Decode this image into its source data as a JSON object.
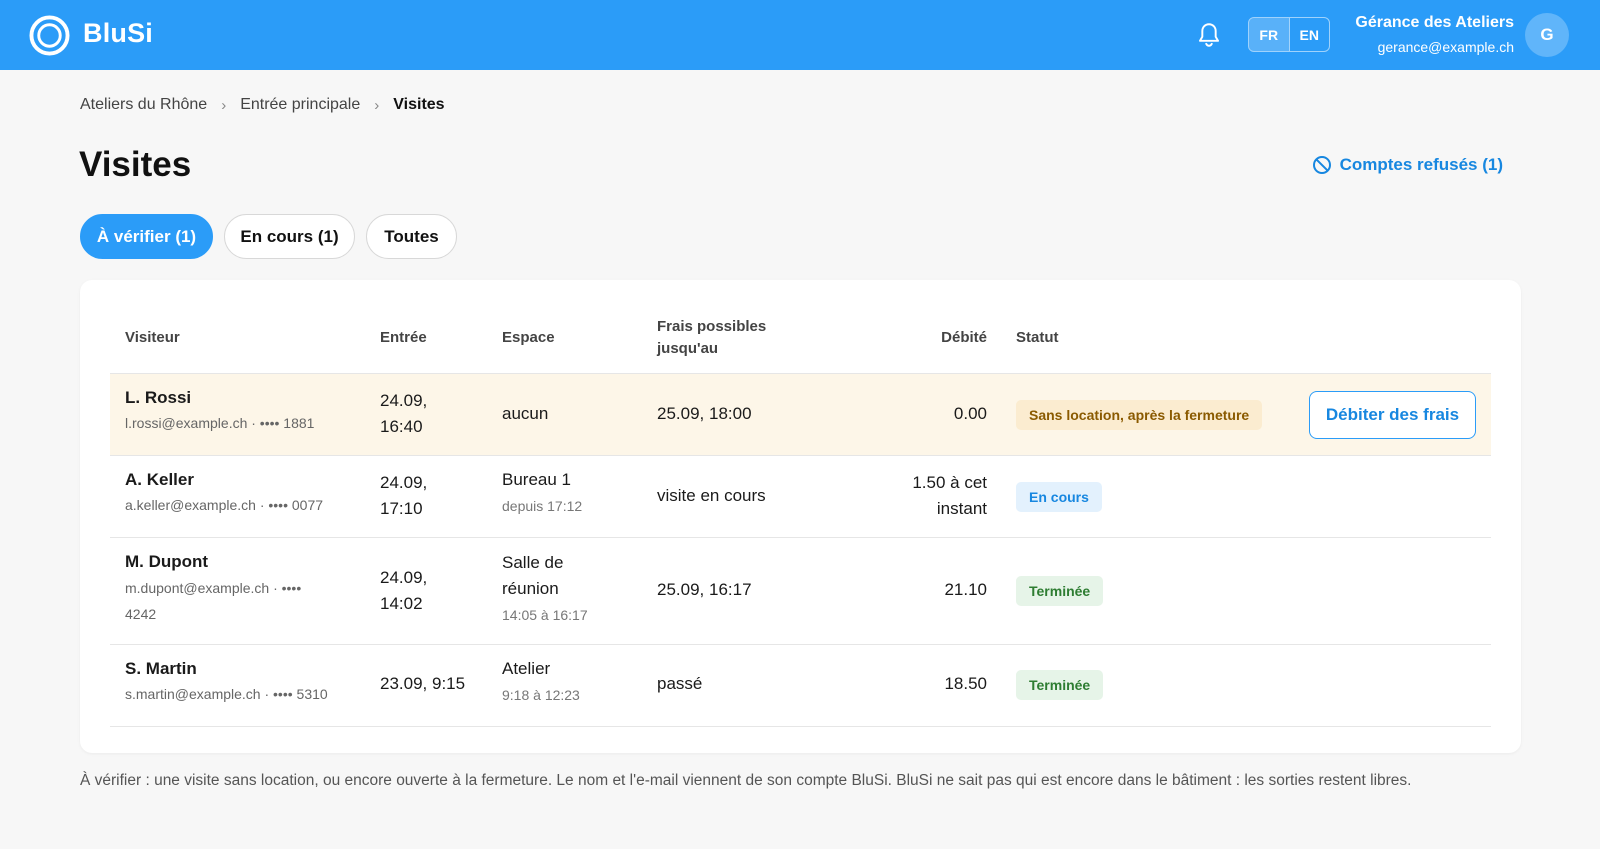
{
  "app": {
    "brand": "BluSi",
    "colors": {
      "primary": "#2b9cf8",
      "link": "#1787e0",
      "warning_bg": "#fdf6e8"
    },
    "icons": {
      "logo": "blusi-logo-icon",
      "notifications": "bell-icon"
    }
  },
  "header": {
    "languages": [
      {
        "code": "FR",
        "active": true
      },
      {
        "code": "EN",
        "active": false
      }
    ],
    "user": {
      "name": "Gérance des Ateliers",
      "email": "gerance@example.ch",
      "initial": "G"
    }
  },
  "breadcrumb": {
    "items": [
      "Ateliers du Rhône",
      "Entrée principale",
      "Visites"
    ]
  },
  "page": {
    "title": "Visites",
    "refused_link": "Comptes refusés (1)"
  },
  "tabs": [
    {
      "label": "À vérifier (1)",
      "active": true
    },
    {
      "label": "En cours (1)",
      "active": false
    },
    {
      "label": "Toutes",
      "active": false
    }
  ],
  "table": {
    "columns": {
      "visitor": "Visiteur",
      "entry": "Entrée",
      "space": "Espace",
      "fees_line1": "Frais possibles",
      "fees_line2": "jusqu'au",
      "charged": "Débité",
      "status": "Statut"
    },
    "rows": [
      {
        "name": "L. Rossi",
        "meta": "l.rossi@example.ch · •••• 1881",
        "entry_line1": "24.09,",
        "entry_line2": "16:40",
        "space": "aucun",
        "fees_until": "25.09, 18:00",
        "charged": "0.00",
        "status": "Sans location, après la fermeture",
        "status_color": "#8a5a00",
        "status_bg": "#fbecd0",
        "action": "Débiter des frais"
      },
      {
        "name": "A. Keller",
        "meta": "a.keller@example.ch · •••• 0077",
        "entry_line1": "24.09,",
        "entry_line2": "17:10",
        "space": "Bureau 1",
        "space_sub": "depuis 17:12",
        "fees_until": "visite en cours",
        "charged_line1": "1.50 à cet",
        "charged_line2": "instant",
        "status": "En cours",
        "status_color": "#1787e0",
        "status_bg": "#e3f1fd"
      },
      {
        "name": "M. Dupont",
        "meta_line1": "m.dupont@example.ch · ••••",
        "meta_line2": "4242",
        "entry_line1": "24.09,",
        "entry_line2": "14:02",
        "space_line1": "Salle de",
        "space_line2": "réunion",
        "space_sub": "14:05 à 16:17",
        "fees_until": "25.09, 16:17",
        "charged": "21.10",
        "status": "Terminée",
        "status_color": "#2e7d32",
        "status_bg": "#e6f4e8"
      },
      {
        "name": "S. Martin",
        "meta": "s.martin@example.ch · •••• 5310",
        "entry": "23.09, 9:15",
        "space": "Atelier",
        "space_sub": "9:18 à 12:23",
        "fees_until": "passé",
        "charged": "18.50",
        "status": "Terminée",
        "status_color": "#2e7d32",
        "status_bg": "#e6f4e8"
      }
    ]
  },
  "footnote": "À vérifier : une visite sans location, ou encore ouverte à la fermeture. Le nom et l'e-mail viennent de son compte BluSi. BluSi ne sait pas qui est encore dans le bâtiment : les sorties restent libres."
}
